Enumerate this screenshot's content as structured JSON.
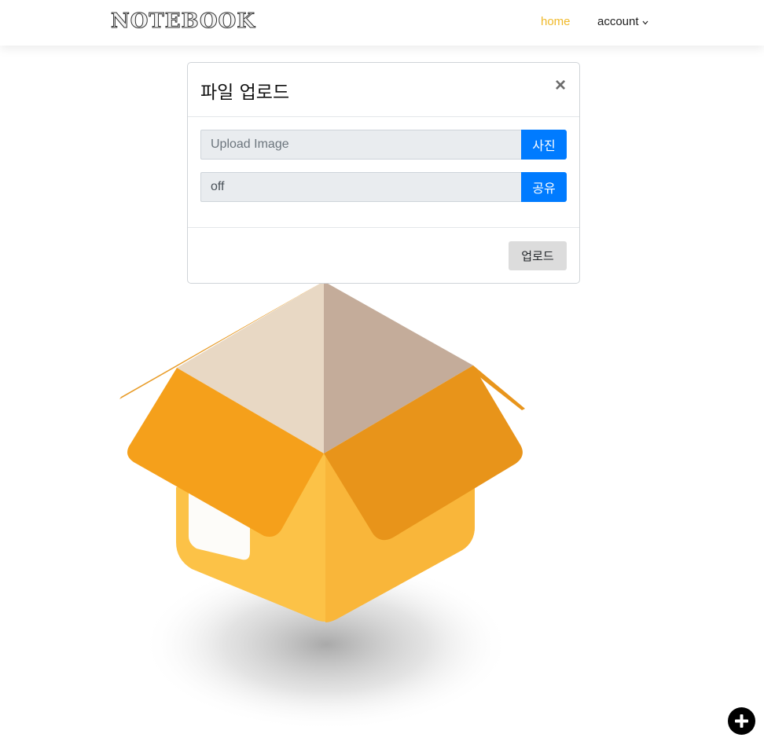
{
  "navbar": {
    "brand": "NOTEBOOK",
    "home_label": "home",
    "account_label": "account",
    "account_icon": "chevron-down-icon",
    "home_color": "#f0b92a"
  },
  "modal": {
    "title": "파일 업로드",
    "close_symbol": "×",
    "image_field": {
      "placeholder": "Upload Image",
      "button_label": "사진"
    },
    "share_field": {
      "value": "off",
      "button_label": "공유"
    },
    "upload_button_label": "업로드",
    "accent_color": "#007bff"
  },
  "illustration": {
    "icon": "open-box-icon"
  },
  "fab": {
    "icon": "plus-icon"
  }
}
